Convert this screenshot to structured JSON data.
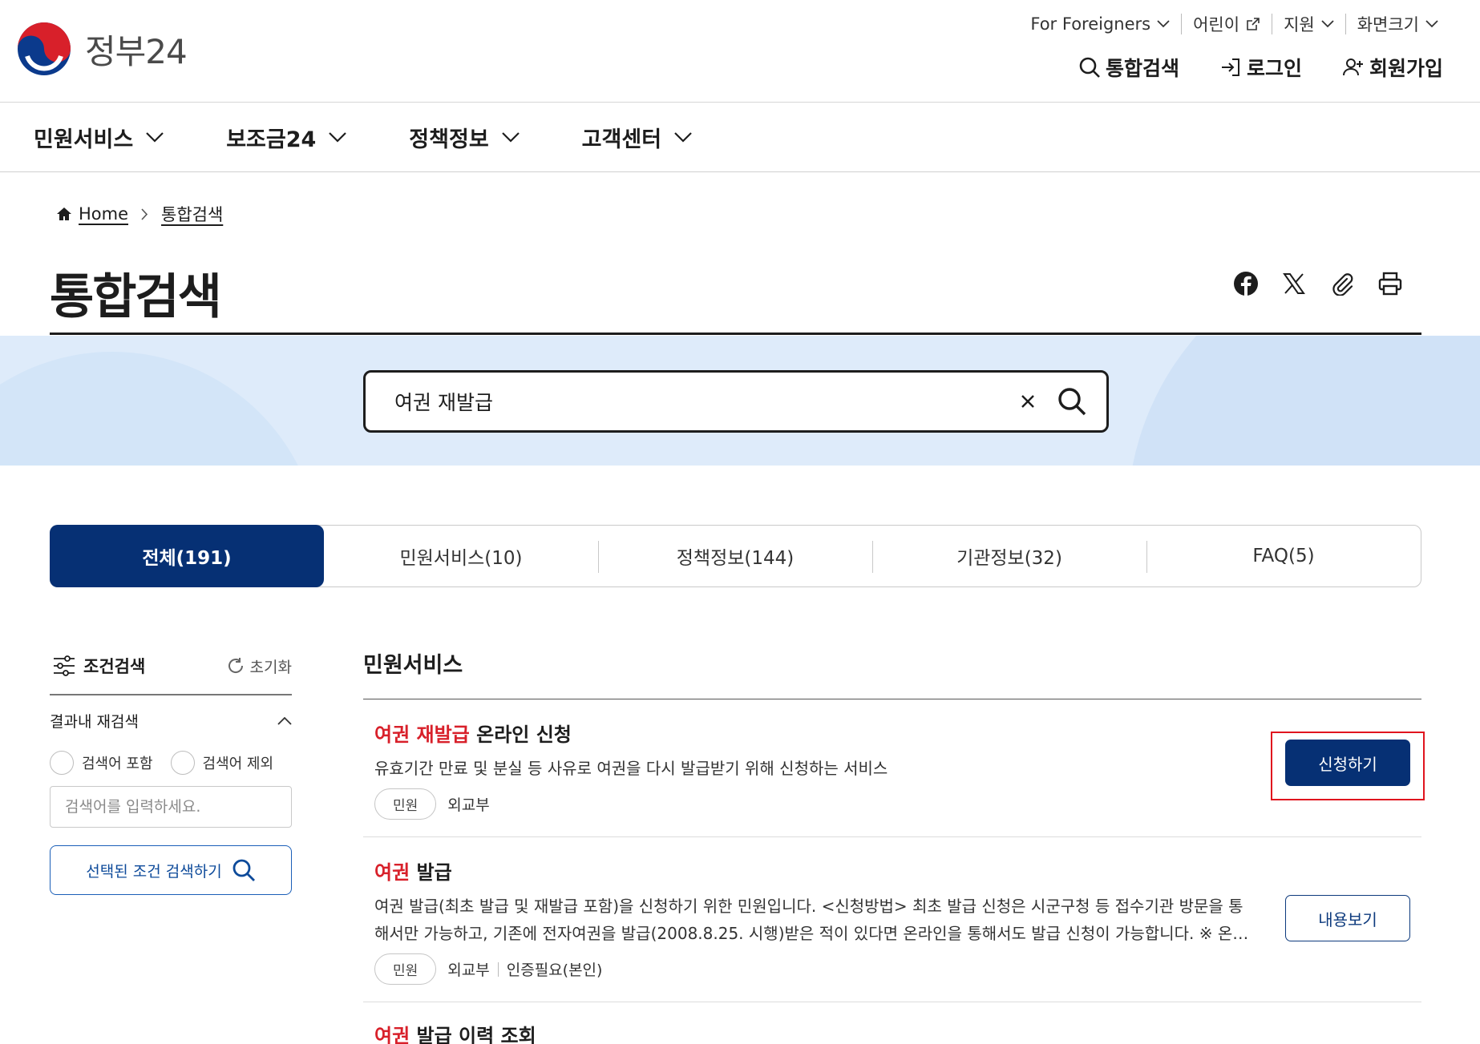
{
  "header": {
    "logo_text": "정부24",
    "util": [
      {
        "label": "For Foreigners"
      },
      {
        "label": "어린이"
      },
      {
        "label": "지원"
      },
      {
        "label": "화면크기"
      }
    ],
    "gnb": {
      "search": "통합검색",
      "login": "로그인",
      "signup": "회원가입"
    }
  },
  "mainnav": {
    "items": [
      "민원서비스",
      "보조금24",
      "정책정보",
      "고객센터"
    ]
  },
  "breadcrumb": {
    "home": "Home",
    "current": "통합검색"
  },
  "page_title": "통합검색",
  "search": {
    "value": "여권 재발급"
  },
  "tabs": [
    {
      "label": "전체(191)",
      "active": true
    },
    {
      "label": "민원서비스(10)"
    },
    {
      "label": "정책정보(144)"
    },
    {
      "label": "기관정보(32)"
    },
    {
      "label": "FAQ(5)"
    }
  ],
  "filter": {
    "title": "조건검색",
    "reset": "초기화",
    "refine_title": "결과내 재검색",
    "include": "검색어 포함",
    "exclude": "검색어 제외",
    "placeholder": "검색어를 입력하세요.",
    "submit": "선택된 조건 검색하기"
  },
  "results": {
    "section_title": "민원서비스",
    "items": [
      {
        "title_hl": "여권 재발급",
        "title_rest": " 온라인 신청",
        "desc": "유효기간 만료 및 분실 등 사유로 여권을 다시 발급받기 위해 신청하는 서비스",
        "badge": "민원",
        "org": "외교부",
        "action": "신청하기"
      },
      {
        "title_hl": "여권",
        "title_rest": " 발급",
        "desc": "여권 발급(최초 발급 및 재발급 포함)을 신청하기 위한 민원입니다. <신청방법> 최초 발급 신청은 시군구청 등 접수기관 방문을 통해서만 가능하고, 기존에 전자여권을 발급(2008.8.25. 시행)받은 적이 있다면 온라인을 통해서도 발급 신청이 가능합니다. ※ 온라인 신청 시",
        "badge": "민원",
        "org": "외교부",
        "extra": "인증필요(본인)",
        "action": "내용보기"
      },
      {
        "title_hl": "여권",
        "title_rest": " 발급 이력 조회"
      }
    ]
  },
  "colors": {
    "primary": "#063074",
    "highlight": "#d8202a",
    "band": "#deebfa",
    "red_box": "#e0141e"
  }
}
